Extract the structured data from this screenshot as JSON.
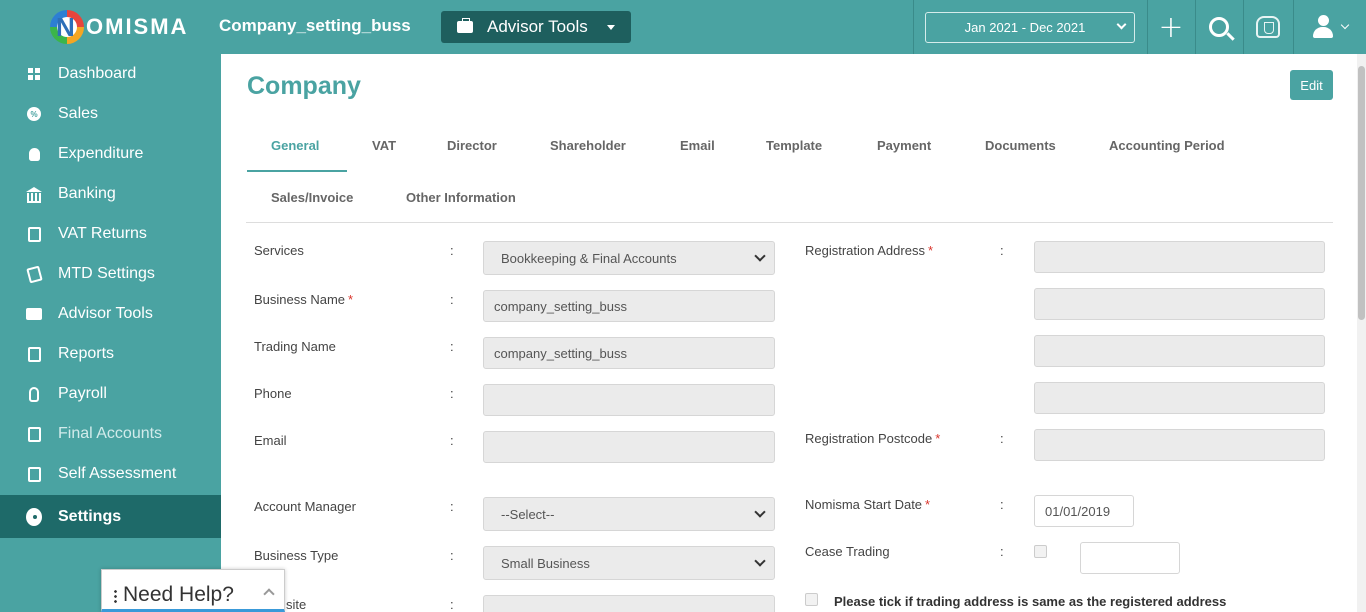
{
  "header": {
    "logo_text": "OMISMA",
    "logo_letter": "N",
    "company_name": "Company_setting_buss",
    "advisor_tools_label": "Advisor Tools",
    "date_range": "Jan 2021 - Dec 2021",
    "plus_symbol": "+"
  },
  "sidebar": {
    "items": [
      {
        "label": "Dashboard"
      },
      {
        "label": "Sales"
      },
      {
        "label": "Expenditure"
      },
      {
        "label": "Banking"
      },
      {
        "label": "VAT Returns"
      },
      {
        "label": "MTD Settings"
      },
      {
        "label": "Advisor Tools"
      },
      {
        "label": "Reports"
      },
      {
        "label": "Payroll"
      },
      {
        "label": "Final Accounts"
      },
      {
        "label": "Self Assessment"
      },
      {
        "label": "Settings"
      }
    ],
    "sales_icon_text": "%"
  },
  "main": {
    "title": "Company",
    "edit_label": "Edit",
    "tabs": [
      "General",
      "VAT",
      "Director",
      "Shareholder",
      "Email",
      "Template",
      "Payment",
      "Documents",
      "Accounting Period",
      "Sales/Invoice",
      "Other Information"
    ],
    "active_tab": "General",
    "colon": ":",
    "required_mark": "*",
    "form": {
      "services_label": "Services",
      "services_value": "Bookkeeping & Final Accounts",
      "business_name_label": "Business Name",
      "business_name_value": "company_setting_buss",
      "trading_name_label": "Trading Name",
      "trading_name_value": "company_setting_buss",
      "phone_label": "Phone",
      "phone_value": "",
      "email_label": "Email",
      "email_value": "",
      "account_manager_label": "Account Manager",
      "account_manager_value": "--Select--",
      "business_type_label": "Business Type",
      "business_type_value": "Small Business",
      "website_label_partial": "site",
      "registration_address_label": "Registration Address",
      "registration_postcode_label": "Registration Postcode",
      "nomisma_start_date_label": "Nomisma Start Date",
      "nomisma_start_date_value": "01/01/2019",
      "cease_trading_label": "Cease Trading",
      "same_address_label": "Please tick if trading address is same as the registered address"
    }
  },
  "help_widget": {
    "label": "Need Help?"
  },
  "colors": {
    "brand_teal": "#4aa3a2",
    "dark_teal": "#1e5f5e",
    "active_nav": "#1e6a69",
    "required_red": "#d9342b"
  }
}
